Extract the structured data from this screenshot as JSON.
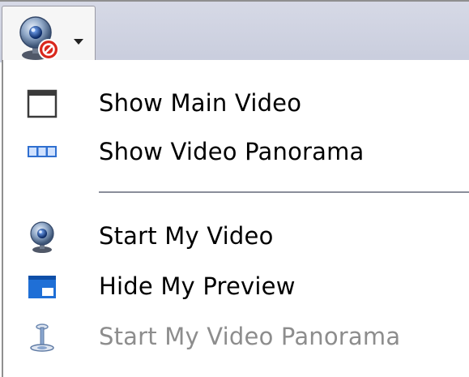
{
  "toolbar": {
    "dropdown_icon": "webcam-blocked-icon"
  },
  "menu": {
    "items": [
      {
        "label": "Show Main Video",
        "icon": "window-icon",
        "enabled": true
      },
      {
        "label": "Show Video Panorama",
        "icon": "panorama-icon",
        "enabled": true
      },
      {
        "label": "Start My Video",
        "icon": "webcam-icon",
        "enabled": true
      },
      {
        "label": "Hide My Preview",
        "icon": "preview-window-icon",
        "enabled": true
      },
      {
        "label": "Start My Video Panorama",
        "icon": "panorama-camera-icon",
        "enabled": false
      }
    ]
  },
  "colors": {
    "toolbar_bg": "#c9cddd",
    "menu_bg": "#ffffff",
    "disabled_text": "#8d8d8d",
    "accent_blue": "#1f6fd6"
  }
}
